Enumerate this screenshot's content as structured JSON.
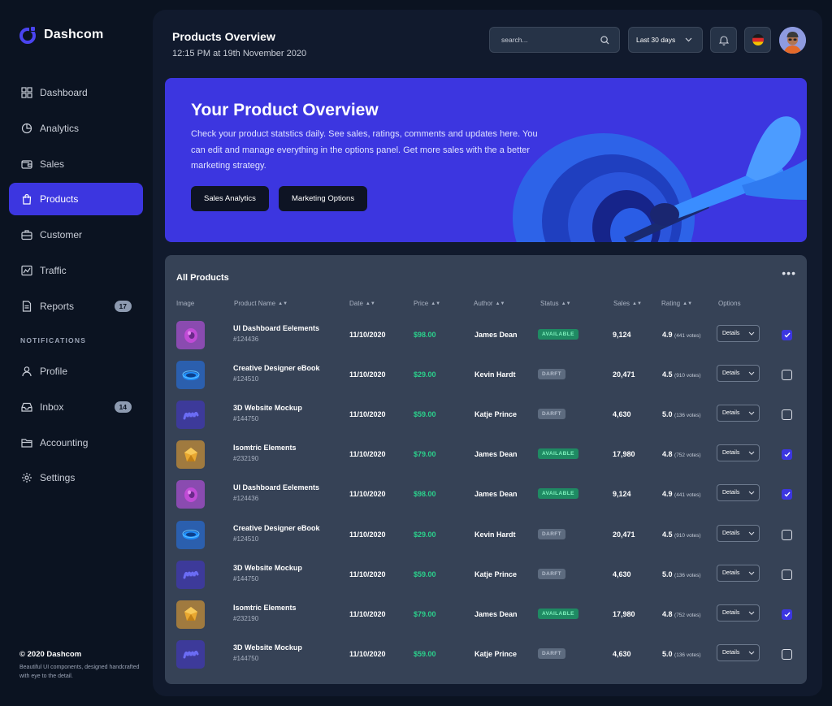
{
  "brand": {
    "name": "Dashcom"
  },
  "nav": [
    {
      "label": "Dashboard",
      "icon": "grid-icon"
    },
    {
      "label": "Analytics",
      "icon": "pie-chart-icon"
    },
    {
      "label": "Sales",
      "icon": "wallet-icon"
    },
    {
      "label": "Products",
      "icon": "bag-icon",
      "active": true
    },
    {
      "label": "Customer",
      "icon": "briefcase-icon"
    },
    {
      "label": "Traffic",
      "icon": "chart-line-icon"
    },
    {
      "label": "Reports",
      "icon": "document-icon",
      "badge": "17"
    }
  ],
  "nav_section": "NOTIFICATIONS",
  "nav2": [
    {
      "label": "Profile",
      "icon": "user-icon"
    },
    {
      "label": "Inbox",
      "icon": "inbox-icon",
      "badge": "14"
    },
    {
      "label": "Accounting",
      "icon": "folder-icon"
    },
    {
      "label": "Settings",
      "icon": "gear-icon"
    }
  ],
  "footer": {
    "title": "© 2020 Dashcom",
    "text": "Beautiful UI components, designed handcrafted with eye to the detail."
  },
  "header": {
    "title": "Products Overview",
    "subtitle": "12:15 PM at 19th November 2020",
    "search_placeholder": "search...",
    "range": "Last 30 days"
  },
  "hero": {
    "title": "Your Product Overview",
    "text": "Check your product statstics daily. See sales, ratings, comments and updates here. You can edit and manage everything in the options panel. Get more sales with the a better marketing strategy.",
    "btn1": "Sales Analytics",
    "btn2": "Marketing Options"
  },
  "products": {
    "title": "All Products",
    "more": "•••",
    "columns": {
      "image": "Image",
      "name": "Product Name",
      "date": "Date",
      "price": "Price",
      "author": "Author",
      "status": "Status",
      "sales": "Sales",
      "rating": "Rating",
      "options": "Options"
    },
    "details_label": "Details",
    "rows": [
      {
        "name": "UI Dashboard Eelements",
        "id": "#124436",
        "date": "11/10/2020",
        "price": "$98.00",
        "author": "James Dean",
        "status": "AVAILABLE",
        "sales": "9,124",
        "rating": "4.9",
        "votes": "(441 votes)",
        "checked": true,
        "thumb": "donut"
      },
      {
        "name": "Creative Designer eBook",
        "id": "#124510",
        "date": "11/10/2020",
        "price": "$29.00",
        "author": "Kevin Hardt",
        "status": "DARFT",
        "sales": "20,471",
        "rating": "4.5",
        "votes": "(910 votes)",
        "checked": false,
        "thumb": "ring"
      },
      {
        "name": "3D Website Mockup",
        "id": "#144750",
        "date": "11/10/2020",
        "price": "$59.00",
        "author": "Katje Prince",
        "status": "DARFT",
        "sales": "4,630",
        "rating": "5.0",
        "votes": "(136 votes)",
        "checked": false,
        "thumb": "spring"
      },
      {
        "name": "Isomtric Elements",
        "id": "#232190",
        "date": "11/10/2020",
        "price": "$79.00",
        "author": "James Dean",
        "status": "AVAILABLE",
        "sales": "17,980",
        "rating": "4.8",
        "votes": "(752 votes)",
        "checked": true,
        "thumb": "gem"
      },
      {
        "name": "UI Dashboard Eelements",
        "id": "#124436",
        "date": "11/10/2020",
        "price": "$98.00",
        "author": "James Dean",
        "status": "AVAILABLE",
        "sales": "9,124",
        "rating": "4.9",
        "votes": "(441 votes)",
        "checked": true,
        "thumb": "donut"
      },
      {
        "name": "Creative Designer eBook",
        "id": "#124510",
        "date": "11/10/2020",
        "price": "$29.00",
        "author": "Kevin Hardt",
        "status": "DARFT",
        "sales": "20,471",
        "rating": "4.5",
        "votes": "(910 votes)",
        "checked": false,
        "thumb": "ring"
      },
      {
        "name": "3D Website Mockup",
        "id": "#144750",
        "date": "11/10/2020",
        "price": "$59.00",
        "author": "Katje Prince",
        "status": "DARFT",
        "sales": "4,630",
        "rating": "5.0",
        "votes": "(136 votes)",
        "checked": false,
        "thumb": "spring"
      },
      {
        "name": "Isomtric Elements",
        "id": "#232190",
        "date": "11/10/2020",
        "price": "$79.00",
        "author": "James Dean",
        "status": "AVAILABLE",
        "sales": "17,980",
        "rating": "4.8",
        "votes": "(752 votes)",
        "checked": true,
        "thumb": "gem"
      },
      {
        "name": "3D Website Mockup",
        "id": "#144750",
        "date": "11/10/2020",
        "price": "$59.00",
        "author": "Katje Prince",
        "status": "DARFT",
        "sales": "4,630",
        "rating": "5.0",
        "votes": "(136 votes)",
        "checked": false,
        "thumb": "spring"
      }
    ]
  },
  "colors": {
    "accent": "#3c36e0",
    "price": "#2bd18c",
    "panel": "#364256",
    "bg": "#0b1321"
  }
}
